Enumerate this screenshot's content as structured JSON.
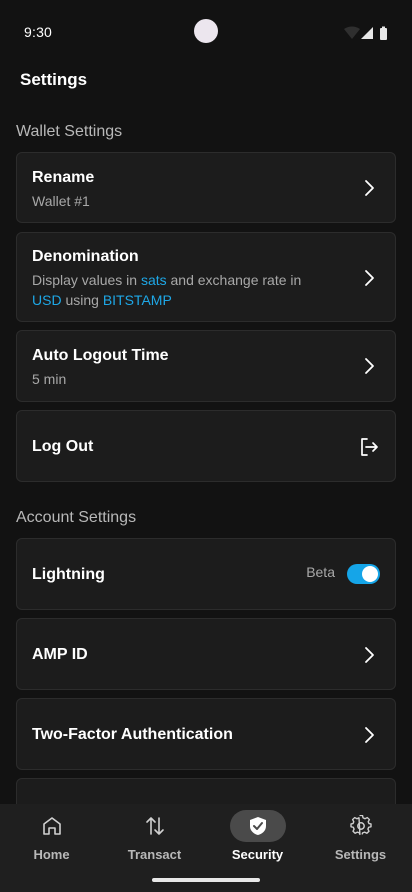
{
  "status_bar": {
    "time": "9:30"
  },
  "header": {
    "title": "Settings"
  },
  "wallet_settings": {
    "title": "Wallet Settings",
    "rename": {
      "title": "Rename",
      "subtitle": "Wallet #1"
    },
    "denomination": {
      "title": "Denomination",
      "line1_prefix": "Display values in ",
      "unit": "sats",
      "line1_suffix": " and exchange rate in",
      "currency": "USD",
      "line2_middle": " using ",
      "exchange": "BITSTAMP"
    },
    "auto_logout": {
      "title": "Auto Logout Time",
      "subtitle": "5 min"
    },
    "logout": {
      "title": "Log Out"
    }
  },
  "account_settings": {
    "title": "Account Settings",
    "lightning": {
      "title": "Lightning",
      "badge": "Beta",
      "enabled": true
    },
    "amp_id": {
      "title": "AMP ID"
    },
    "two_factor": {
      "title": "Two-Factor Authentication"
    }
  },
  "bottom_nav": {
    "items": [
      {
        "label": "Home",
        "icon": "home-icon"
      },
      {
        "label": "Transact",
        "icon": "transfer-arrows-icon"
      },
      {
        "label": "Security",
        "icon": "shield-check-icon",
        "active": true
      },
      {
        "label": "Settings",
        "icon": "gear-icon"
      }
    ]
  },
  "colors": {
    "accent": "#1ea7e6",
    "background": "#121212",
    "card": "#1c1c1c",
    "toggle_on": "#15a5e8"
  }
}
